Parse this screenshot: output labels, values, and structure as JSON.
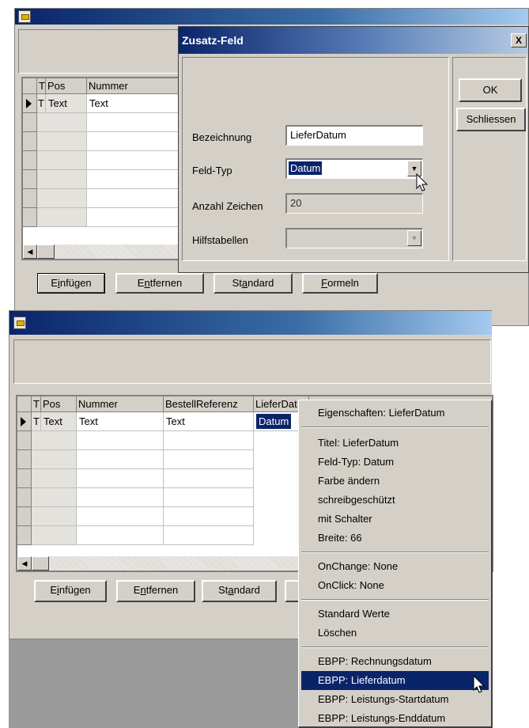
{
  "window1": {
    "grid": {
      "columns": [
        "T",
        "Pos",
        "Nummer"
      ],
      "row1": [
        "T",
        "Text",
        "Text"
      ]
    },
    "buttons": {
      "insert": {
        "pre": "E",
        "u": "i",
        "post": "nfügen"
      },
      "remove": {
        "pre": "E",
        "u": "n",
        "post": "tfernen"
      },
      "standard": {
        "pre": "St",
        "u": "a",
        "post": "ndard"
      },
      "formulas": {
        "pre": "",
        "u": "F",
        "post": "ormeln"
      }
    }
  },
  "dialog": {
    "title": "Zusatz-Feld",
    "close_glyph": "X",
    "labels": {
      "name": "Bezeichnung",
      "type": "Feld-Typ",
      "chars": "Anzahl Zeichen",
      "tables": "Hilfstabellen"
    },
    "values": {
      "name": "LieferDatum",
      "type": "Datum",
      "chars": "20",
      "tables": ""
    },
    "ok": "OK",
    "close": "Schliessen"
  },
  "window2": {
    "grid": {
      "columns": [
        "T",
        "Pos",
        "Nummer",
        "BestellReferenz",
        "LieferDat"
      ],
      "row1": [
        "T",
        "Text",
        "Text",
        "Text",
        "Datum"
      ]
    },
    "buttons": {
      "insert": {
        "pre": "E",
        "u": "i",
        "post": "nfügen"
      },
      "remove": {
        "pre": "E",
        "u": "n",
        "post": "tfernen"
      },
      "standard": {
        "pre": "St",
        "u": "a",
        "post": "ndard"
      }
    }
  },
  "context_menu": {
    "header": "Eigenschaften: LieferDatum",
    "group1": [
      "Titel: LieferDatum",
      "Feld-Typ: Datum",
      "Farbe ändern",
      "schreibgeschützt",
      "mit Schalter",
      "Breite: 66"
    ],
    "group2": [
      "OnChange: None",
      "OnClick: None"
    ],
    "group3": [
      "Standard Werte",
      "Löschen"
    ],
    "group4": [
      "EBPP: Rechnungsdatum",
      "EBPP: Lieferdatum",
      "EBPP: Leistungs-Startdatum",
      "EBPP: Leistungs-Enddatum"
    ],
    "highlighted": "EBPP: Lieferdatum"
  },
  "colors": {
    "titlebar_start": "#0a246a",
    "titlebar_end": "#a6caf0",
    "face": "#d4d0c8",
    "highlight": "#0a246a"
  }
}
